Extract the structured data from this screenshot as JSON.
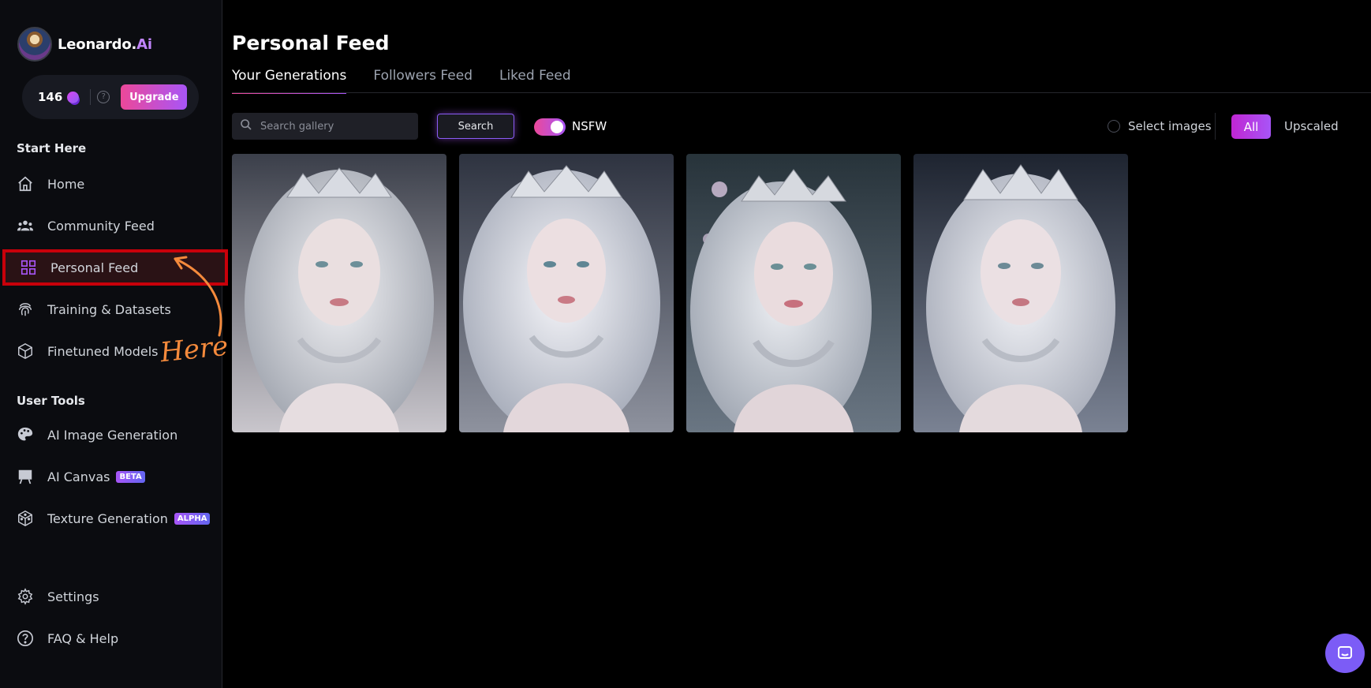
{
  "app": {
    "name_main": "Leonardo.",
    "name_accent": "Ai"
  },
  "credits": {
    "count": "146",
    "upgrade_label": "Upgrade",
    "help_glyph": "?"
  },
  "sidebar": {
    "section_start": "Start Here",
    "section_tools": "User Tools",
    "items": [
      {
        "label": "Home",
        "icon": "home-icon"
      },
      {
        "label": "Community Feed",
        "icon": "users-icon"
      },
      {
        "label": "Personal Feed",
        "icon": "grid-icon"
      },
      {
        "label": "Training & Datasets",
        "icon": "fingerprint-icon"
      },
      {
        "label": "Finetuned Models",
        "icon": "cube-icon"
      }
    ],
    "tools": [
      {
        "label": "AI Image Generation",
        "icon": "palette-icon",
        "badge": ""
      },
      {
        "label": "AI Canvas",
        "icon": "easel-icon",
        "badge": "BETA"
      },
      {
        "label": "Texture Generation",
        "icon": "dice-icon",
        "badge": "ALPHA"
      }
    ],
    "footer": [
      {
        "label": "Settings",
        "icon": "gear-icon"
      },
      {
        "label": "FAQ & Help",
        "icon": "question-icon"
      }
    ]
  },
  "annotation": {
    "text": "Here !!",
    "color": "#f48a3c"
  },
  "main": {
    "title": "Personal Feed",
    "tabs": [
      {
        "label": "Your Generations",
        "active": true
      },
      {
        "label": "Followers Feed",
        "active": false
      },
      {
        "label": "Liked Feed",
        "active": false
      }
    ],
    "search_placeholder": "Search gallery",
    "search_button": "Search",
    "nsfw_label": "NSFW",
    "nsfw_enabled": true,
    "select_images_label": "Select images",
    "filter_all": "All",
    "filter_upscaled": "Upscaled"
  },
  "colors": {
    "accent_pink": "#ec4899",
    "accent_purple": "#a855f7",
    "highlight_red": "#c8000a",
    "background": "#000000"
  }
}
